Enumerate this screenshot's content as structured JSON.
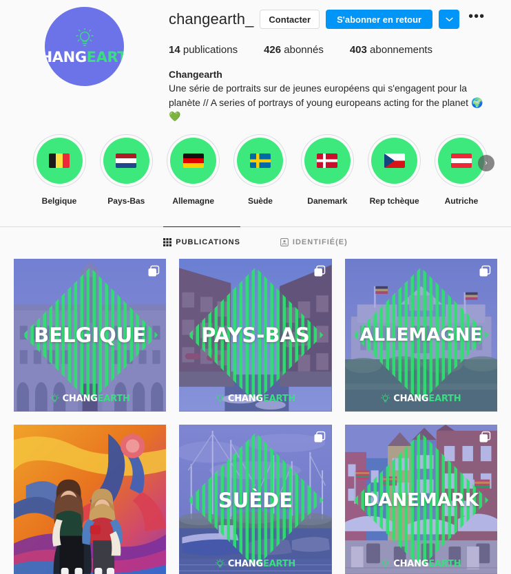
{
  "profile": {
    "username": "changearth_",
    "avatar_logo_white": "CHANG",
    "avatar_logo_green": "EARTH",
    "contact_button": "Contacter",
    "follow_button": "S'abonner en retour",
    "chevron_icon": "chevron-down-icon",
    "more_icon": "more-options-icon",
    "stats": [
      {
        "value": "14",
        "label": "publications"
      },
      {
        "value": "426",
        "label": "abonnés"
      },
      {
        "value": "403",
        "label": "abonnements"
      }
    ],
    "full_name": "Changearth",
    "bio": "Une série de portraits sur de jeunes européens qui s'engagent pour la planète // A series of portrays of young europeans acting for the planet 🌍💚"
  },
  "highlights": {
    "next_arrow": "›",
    "items": [
      {
        "label": "Belgique",
        "flag": "be"
      },
      {
        "label": "Pays-Bas",
        "flag": "nl"
      },
      {
        "label": "Allemagne",
        "flag": "de"
      },
      {
        "label": "Suède",
        "flag": "se"
      },
      {
        "label": "Danemark",
        "flag": "dk"
      },
      {
        "label": "Rep tchèque",
        "flag": "cz"
      },
      {
        "label": "Autriche",
        "flag": "at"
      }
    ]
  },
  "tabs": [
    {
      "label": "PUBLICATIONS",
      "icon": "grid-icon",
      "active": true
    },
    {
      "label": "IDENTIFIÉ(E)",
      "icon": "tagged-person-icon",
      "active": false
    }
  ],
  "posts": [
    {
      "title": "BELGIQUE",
      "scene": "brussels-grand-place",
      "carousel": true,
      "watermark_white": "CHANG",
      "watermark_green": "EARTH"
    },
    {
      "title": "PAYS-BAS",
      "scene": "amsterdam-canal",
      "carousel": true,
      "watermark_white": "CHANG",
      "watermark_green": "EARTH"
    },
    {
      "title": "ALLEMAGNE",
      "scene": "berlin-reichstag",
      "carousel": true,
      "watermark_white": "CHANG",
      "watermark_green": "EARTH"
    },
    {
      "title": "",
      "scene": "mural-portrait",
      "carousel": false,
      "watermark_white": "",
      "watermark_green": ""
    },
    {
      "title": "SUÈDE",
      "scene": "harbour-sailboats",
      "carousel": true,
      "watermark_white": "CHANG",
      "watermark_green": "EARTH"
    },
    {
      "title": "DANEMARK",
      "scene": "copenhagen-nyhavn",
      "carousel": true,
      "watermark_white": "CHANG",
      "watermark_green": "EARTH"
    }
  ],
  "colors": {
    "instagram_blue": "#0095F6",
    "highlight_green": "#3DE87D",
    "logo_green": "#3DDC84",
    "avatar_purple": "#6C72E8",
    "page_background": "#FAFAFA",
    "border": "#DBDBDB"
  }
}
